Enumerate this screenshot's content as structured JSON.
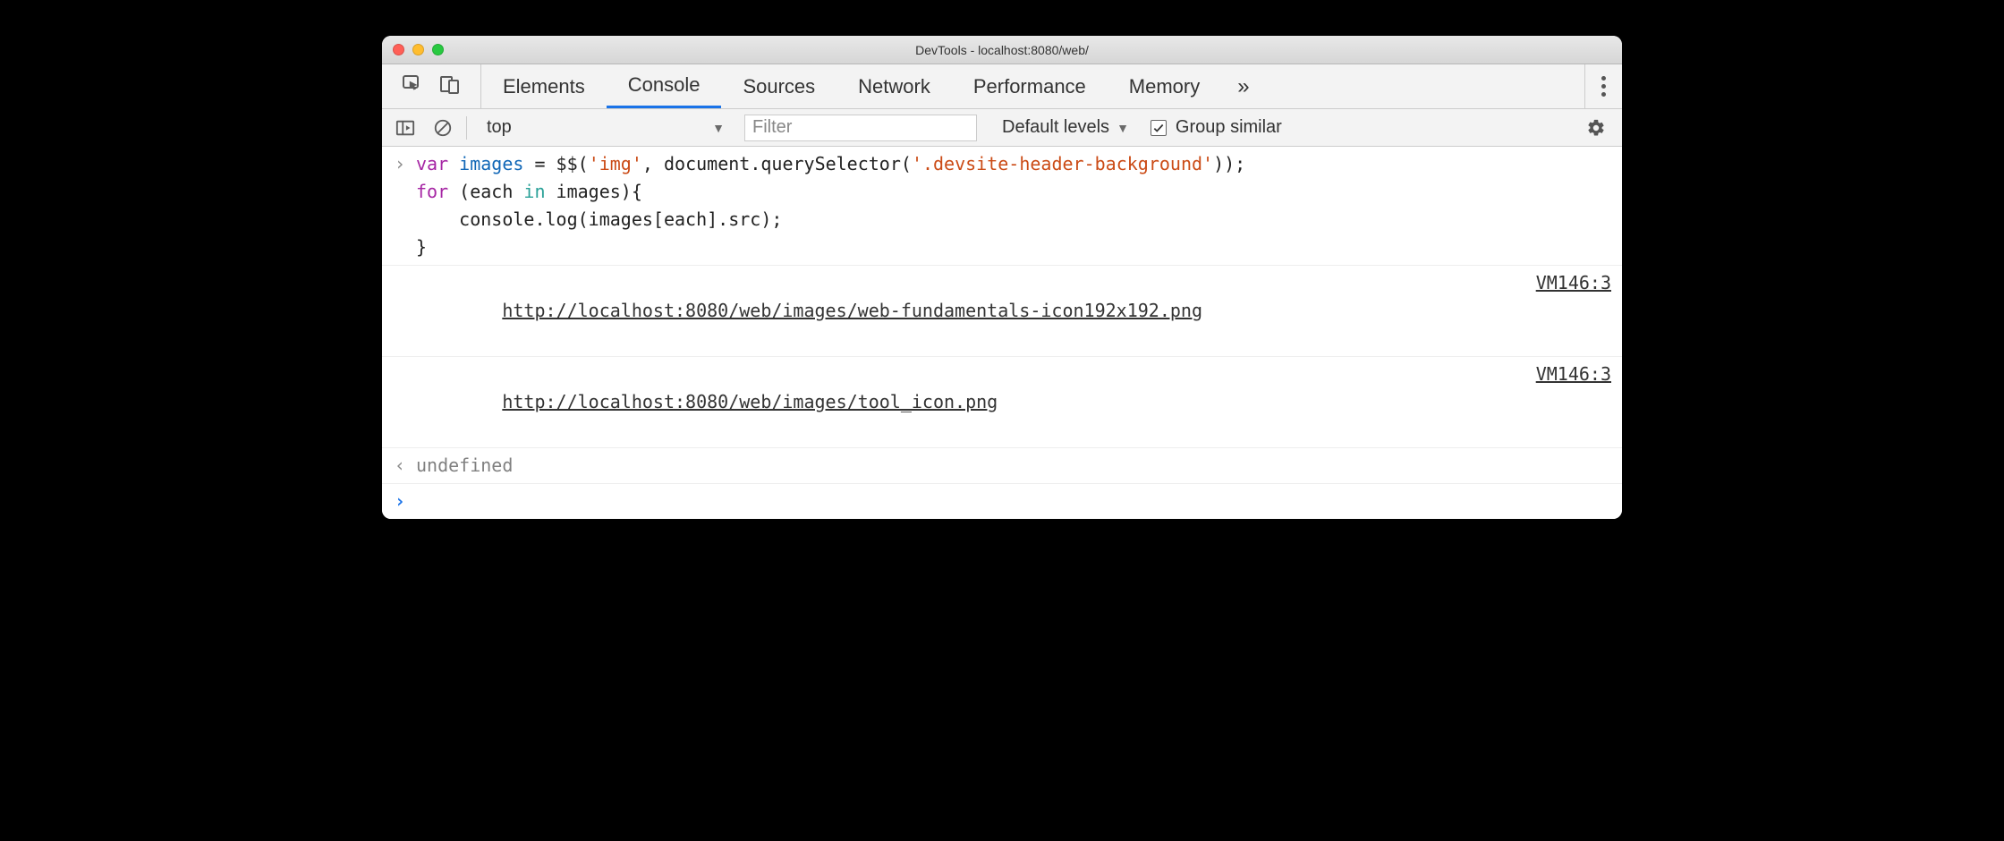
{
  "window": {
    "title": "DevTools - localhost:8080/web/"
  },
  "tabs": {
    "items": [
      "Elements",
      "Console",
      "Sources",
      "Network",
      "Performance",
      "Memory"
    ],
    "active_index": 1,
    "overflow_label": "»"
  },
  "toolbar": {
    "context": "top",
    "filter_placeholder": "Filter",
    "levels_label": "Default levels",
    "group_similar_label": "Group similar",
    "group_similar_checked": true
  },
  "console": {
    "input_code_html": "<span class=\"kw\">var</span> <span class=\"v\">images</span> <span class=\"plain\">= $$(</span><span class=\"str\">'img'</span><span class=\"plain\">, document.querySelector(</span><span class=\"str\">'.devsite-header-background'</span><span class=\"plain\">));</span>\n<span class=\"kw3\">for</span> <span class=\"plain\">(each </span><span class=\"kw2\">in</span><span class=\"plain\"> images){</span>\n<span class=\"plain\">    console.log(images[each].src);</span>\n<span class=\"plain\">}</span>",
    "logs": [
      {
        "message": "http://localhost:8080/web/images/web-fundamentals-icon192x192.png",
        "source": "VM146:3"
      },
      {
        "message": "http://localhost:8080/web/images/tool_icon.png",
        "source": "VM146:3"
      }
    ],
    "result_text": "undefined"
  }
}
